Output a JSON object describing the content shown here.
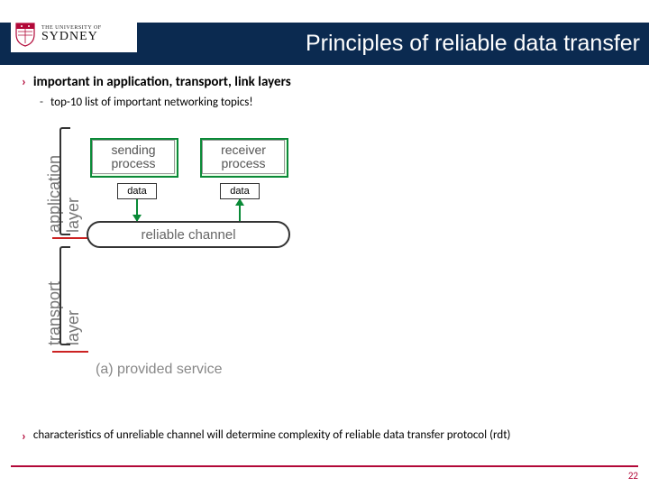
{
  "logo": {
    "top_line": "THE UNIVERSITY OF",
    "bottom_line": "SYDNEY"
  },
  "title": "Principles of reliable data transfer",
  "bullets": {
    "b1": "important in application, transport, link layers",
    "b2": "top-10 list of important networking topics!",
    "b3": "characteristics of unreliable channel will determine complexity of reliable data transfer protocol (rdt)"
  },
  "diagram": {
    "app_layer": "application\nlayer",
    "trans_layer": "transport\nlayer",
    "sending_l1": "sending",
    "sending_l2": "process",
    "receiver_l1": "receiver",
    "receiver_l2": "process",
    "data": "data",
    "channel": "reliable channel",
    "caption": "(a)  provided service"
  },
  "page_number": "22"
}
